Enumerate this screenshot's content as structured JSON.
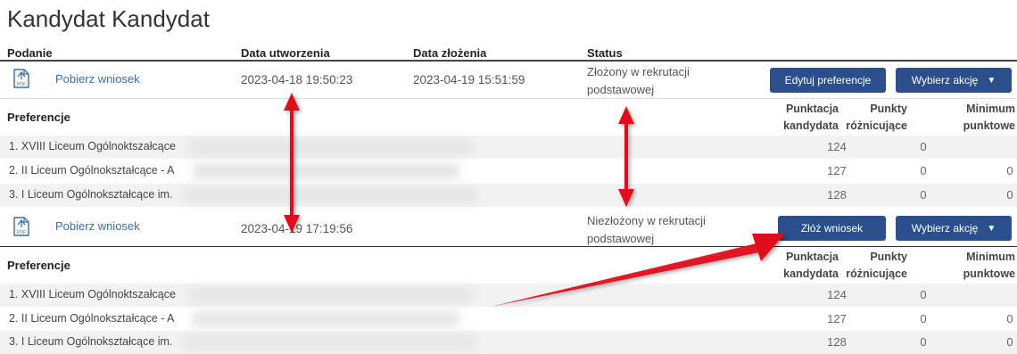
{
  "title": "Kandydat Kandydat",
  "headers": {
    "podanie": "Podanie",
    "created": "Data utworzenia",
    "submitted": "Data złożenia",
    "status": "Status"
  },
  "icons": {
    "pdf": "pdf-file-icon",
    "chevron": "chevron-down-icon"
  },
  "colors": {
    "button_bg": "#2b4f8a",
    "link": "#3a6ea5",
    "arrow": "#e0101a"
  },
  "applications": [
    {
      "download_label": "Pobierz wniosek",
      "created": "2023-04-18 19:50:23",
      "submitted": "2023-04-19 15:51:59",
      "status": "Złożony w rekrutacji podstawowej",
      "primary_button": "Edytuj preferencje",
      "action_button": "Wybierz akcję",
      "preferences_title": "Preferencje",
      "col_points": "Punktacja kandydata",
      "col_diff": "Punkty różnicujące",
      "col_min": "Minimum punktowe",
      "rows": [
        {
          "name": "1. XVIII Liceum Ogólnoktszałcące",
          "points": "124",
          "diff": "0",
          "min": ""
        },
        {
          "name": "2. II Liceum Ogólnokształcące - A",
          "points": "127",
          "diff": "0",
          "min": "0"
        },
        {
          "name": "3. I Liceum Ogólnokształcące im.",
          "points": "128",
          "diff": "0",
          "min": "0"
        }
      ]
    },
    {
      "download_label": "Pobierz wniosek",
      "created": "2023-04-19 17:19:56",
      "submitted": "",
      "status": "Niezłożony w rekrutacji podstawowej",
      "primary_button": "Złóż wniosek",
      "action_button": "Wybierz akcję",
      "preferences_title": "Preferencje",
      "col_points": "Punktacja kandydata",
      "col_diff": "Punkty różnicujące",
      "col_min": "Minimum punktowe",
      "rows": [
        {
          "name": "1. XVIII Liceum Ogólnoktszałcące",
          "points": "124",
          "diff": "0",
          "min": ""
        },
        {
          "name": "2. II Liceum Ogólnokształcące - A",
          "points": "127",
          "diff": "0",
          "min": "0"
        },
        {
          "name": "3. I Liceum Ogólnokształcące im.",
          "points": "128",
          "diff": "0",
          "min": "0"
        }
      ]
    }
  ]
}
